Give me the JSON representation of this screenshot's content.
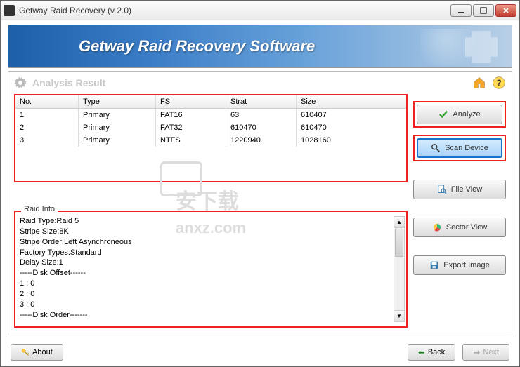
{
  "window": {
    "title": "Getway Raid Recovery (v 2.0)"
  },
  "banner": {
    "title": "Getway Raid Recovery Software"
  },
  "section": {
    "title": "Analysis Result"
  },
  "table": {
    "headers": {
      "no": "No.",
      "type": "Type",
      "fs": "FS",
      "strat": "Strat",
      "size": "Size"
    },
    "rows": [
      {
        "no": "1",
        "type": "Primary",
        "fs": "FAT16",
        "strat": "63",
        "size": "610407"
      },
      {
        "no": "2",
        "type": "Primary",
        "fs": "FAT32",
        "strat": "610470",
        "size": "610470"
      },
      {
        "no": "3",
        "type": "Primary",
        "fs": "NTFS",
        "strat": "1220940",
        "size": "1028160"
      }
    ]
  },
  "raid": {
    "legend": "Raid Info",
    "lines": [
      "Raid Type:Raid 5",
      "Stripe Size:8K",
      "Stripe Order:Left Asynchroneous",
      "Factory Types:Standard",
      "Delay Size:1",
      "-----Disk Offset------",
      "1 : 0",
      "2 : 0",
      "3 : 0",
      "-----Disk Order-------"
    ]
  },
  "buttons": {
    "analyze": "Analyze",
    "scan": "Scan Device",
    "file_view": "File View",
    "sector_view": "Sector View",
    "export": "Export Image"
  },
  "footer": {
    "about": "About",
    "back": "Back",
    "next": "Next"
  },
  "watermark": {
    "text": "安下载",
    "url": "anxz.com"
  }
}
